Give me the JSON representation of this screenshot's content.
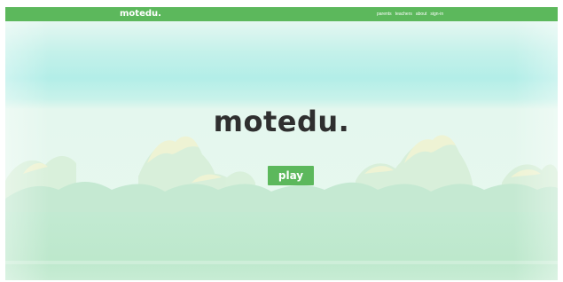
{
  "navbar": {
    "brand": "motedu.",
    "links": [
      {
        "label": "parents"
      },
      {
        "label": "teachers"
      },
      {
        "label": "about"
      },
      {
        "label": "sign-in"
      }
    ]
  },
  "hero": {
    "title": "motedu.",
    "play_label": "play"
  },
  "colors": {
    "brand_green": "#5cb85c",
    "sky_cyan": "#b6efe9",
    "pale_mint": "#e6f8ee",
    "hill_green": "#bfe8cd",
    "title_text": "#2f2f2f"
  }
}
